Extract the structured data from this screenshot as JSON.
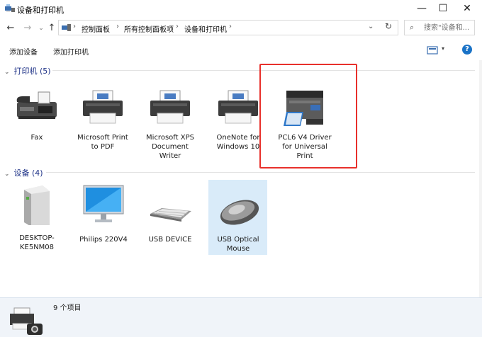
{
  "window": {
    "title": "设备和打印机",
    "controls": {
      "minimize": "—",
      "maximize": "☐",
      "close": "✕"
    }
  },
  "nav": {
    "back": "←",
    "forward": "→",
    "recent": "⌄",
    "up": "↑",
    "breadcrumb": [
      "控制面板",
      "所有控制面板项",
      "设备和打印机"
    ],
    "separator": "›",
    "dropdown": "⌄",
    "refresh": "↻",
    "search_icon": "⌕",
    "search_placeholder": "搜索\"设备和...",
    "search_value": ""
  },
  "commands": {
    "add_device": "添加设备",
    "add_printer": "添加打印机",
    "view_dropdown": "▾",
    "help": "?"
  },
  "groups": {
    "printers": {
      "header": "打印机 (5)",
      "chevron": "⌄",
      "items": [
        {
          "label": "Fax",
          "icon": "fax-icon"
        },
        {
          "label": "Microsoft Print to PDF",
          "icon": "printer-icon"
        },
        {
          "label": "Microsoft XPS Document Writer",
          "icon": "printer-icon"
        },
        {
          "label": "OneNote for Windows 10",
          "icon": "printer-icon"
        },
        {
          "label": "PCL6 V4 Driver for Universal Print",
          "icon": "multifunction-printer-icon"
        }
      ]
    },
    "devices": {
      "header": "设备 (4)",
      "chevron": "⌄",
      "items": [
        {
          "label": "DESKTOP-KE5NM08",
          "icon": "computer-tower-icon"
        },
        {
          "label": "Philips 220V4",
          "icon": "monitor-icon"
        },
        {
          "label": "USB DEVICE",
          "icon": "keyboard-icon"
        },
        {
          "label": "USB Optical Mouse",
          "icon": "mouse-icon"
        }
      ]
    }
  },
  "details": {
    "count": "9 个项目"
  },
  "colors": {
    "group_header": "#1e3287",
    "selection": "#d9ebf9",
    "highlight_box": "#e8302b",
    "help_badge": "#1a73c7"
  }
}
